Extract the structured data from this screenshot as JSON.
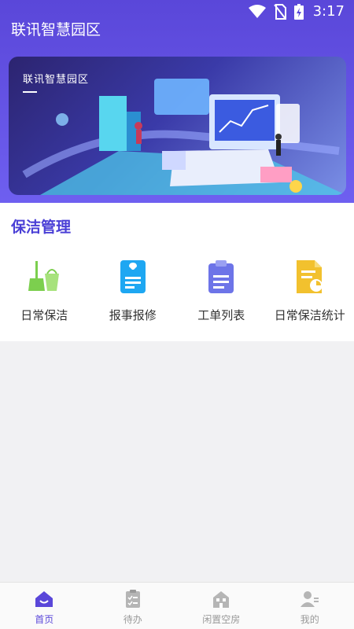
{
  "status_bar": {
    "time": "3:17"
  },
  "app": {
    "title": "联讯智慧园区"
  },
  "banner": {
    "title": "联讯智慧园区"
  },
  "section": {
    "title": "保洁管理",
    "items": [
      {
        "label": "日常保洁",
        "icon": "broom-bucket-icon",
        "color": "#7ccf4e"
      },
      {
        "label": "报事报修",
        "icon": "wrench-ticket-icon",
        "color": "#1ea7f2"
      },
      {
        "label": "工单列表",
        "icon": "clipboard-list-icon",
        "color": "#6d74e8"
      },
      {
        "label": "日常保洁统计",
        "icon": "document-stats-icon",
        "color": "#f2c12e"
      }
    ]
  },
  "tabbar": {
    "active_color": "#5a47d9",
    "inactive_color": "#b5b5b5",
    "tabs": [
      {
        "label": "首页",
        "icon": "home-icon",
        "active": true
      },
      {
        "label": "待办",
        "icon": "checklist-icon",
        "active": false
      },
      {
        "label": "闲置空房",
        "icon": "building-icon",
        "active": false
      },
      {
        "label": "我的",
        "icon": "user-icon",
        "active": false
      }
    ]
  }
}
